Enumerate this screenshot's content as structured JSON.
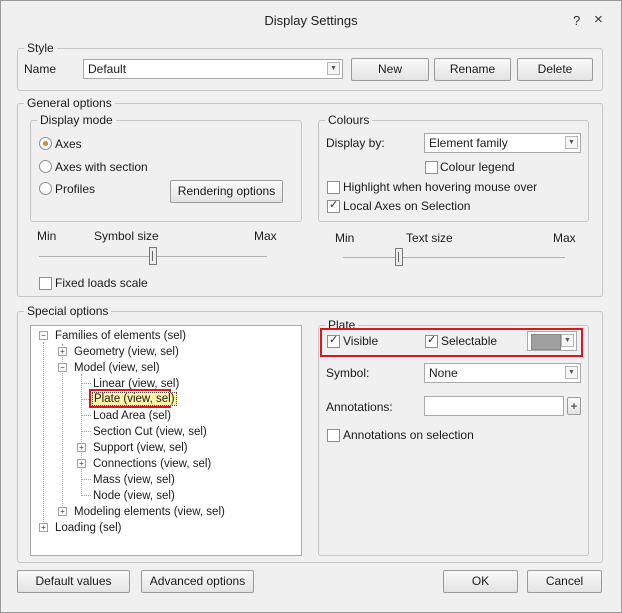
{
  "window": {
    "title": "Display Settings",
    "help_icon": "?",
    "close_icon": "×"
  },
  "style": {
    "group_title": "Style",
    "name_label": "Name",
    "name_value": "Default",
    "new_button": "New",
    "rename_button": "Rename",
    "delete_button": "Delete"
  },
  "general": {
    "group_title": "General options",
    "display_mode": {
      "title": "Display mode",
      "options": [
        "Axes",
        "Axes with section",
        "Profiles"
      ],
      "selected": "Axes",
      "rendering_button": "Rendering options"
    },
    "colours": {
      "title": "Colours",
      "display_by_label": "Display by:",
      "display_by_value": "Element family",
      "colour_legend": "Colour legend",
      "colour_legend_checked": false,
      "highlight_hover": "Highlight when hovering mouse over",
      "highlight_hover_checked": false,
      "local_axes": "Local Axes on Selection",
      "local_axes_checked": true
    },
    "symbol_slider": {
      "min": "Min",
      "label": "Symbol size",
      "max": "Max",
      "level": 0.5
    },
    "text_slider": {
      "min": "Min",
      "label": "Text size",
      "max": "Max",
      "level": 0.25
    },
    "fixed_loads": "Fixed loads scale",
    "fixed_loads_checked": false
  },
  "special": {
    "group_title": "Special options",
    "tree": [
      {
        "label": "Families of elements (sel)",
        "level": 0,
        "toggle": "−"
      },
      {
        "label": "Geometry (view, sel)",
        "level": 1,
        "toggle": "+"
      },
      {
        "label": "Model (view, sel)",
        "level": 1,
        "toggle": "−"
      },
      {
        "label": "Linear (view, sel)",
        "level": 2,
        "toggle": ""
      },
      {
        "label": "Plate (view, sel)",
        "level": 2,
        "toggle": "",
        "selected": true
      },
      {
        "label": "Load Area (sel)",
        "level": 2,
        "toggle": ""
      },
      {
        "label": "Section Cut (view, sel)",
        "level": 2,
        "toggle": ""
      },
      {
        "label": "Support (view, sel)",
        "level": 2,
        "toggle": "+"
      },
      {
        "label": "Connections (view, sel)",
        "level": 2,
        "toggle": "+"
      },
      {
        "label": "Mass (view, sel)",
        "level": 2,
        "toggle": ""
      },
      {
        "label": "Node (view, sel)",
        "level": 2,
        "toggle": ""
      },
      {
        "label": "Modeling elements (view, sel)",
        "level": 1,
        "toggle": "+"
      },
      {
        "label": "Loading  (sel)",
        "level": 0,
        "toggle": "+"
      }
    ],
    "plate": {
      "title": "Plate",
      "visible": "Visible",
      "visible_checked": true,
      "selectable": "Selectable",
      "selectable_checked": true,
      "colour": "#a0a0a0",
      "symbol_label": "Symbol:",
      "symbol_value": "None",
      "annotations_label": "Annotations:",
      "annotations_value": "",
      "annotations_add": "+",
      "annotations_on_selection": "Annotations on selection",
      "annotations_on_selection_checked": false
    }
  },
  "footer": {
    "default_values": "Default values",
    "advanced_options": "Advanced options",
    "ok": "OK",
    "cancel": "Cancel"
  },
  "colors": {
    "highlight": "#e0141e",
    "radio_accent": "#d88a1c",
    "tree_selection": "#fff3a8"
  }
}
